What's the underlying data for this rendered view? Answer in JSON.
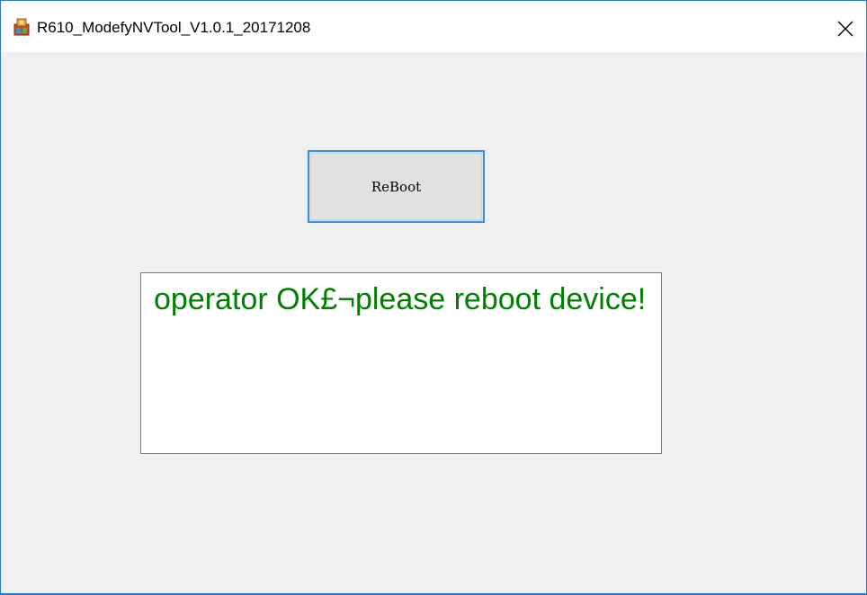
{
  "window": {
    "title": "R610_ModefyNVTool_V1.0.1_20171208",
    "app_icon": "app-icon",
    "close_icon": "close-icon",
    "accent_color": "#2b79d1"
  },
  "main": {
    "reboot_label": "ReBoot",
    "status_text": "operator OK£¬please reboot device!",
    "status_color": "#008000"
  }
}
